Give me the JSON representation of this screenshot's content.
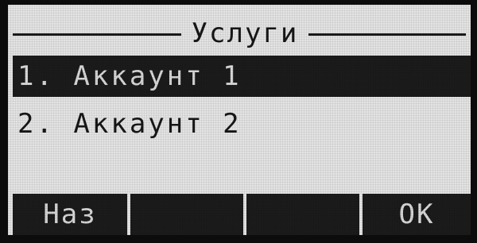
{
  "screen": {
    "title": "Услуги",
    "menu": [
      {
        "label": "1. Аккаунт 1",
        "selected": true
      },
      {
        "label": "2. Аккаунт 2",
        "selected": false
      }
    ],
    "softkeys": [
      "Наз",
      "",
      "",
      "ОК"
    ]
  },
  "colors": {
    "lcd_background": "#e3e3e3",
    "lcd_ink": "#1b1b1b",
    "bezel": "#0c0c0c"
  }
}
